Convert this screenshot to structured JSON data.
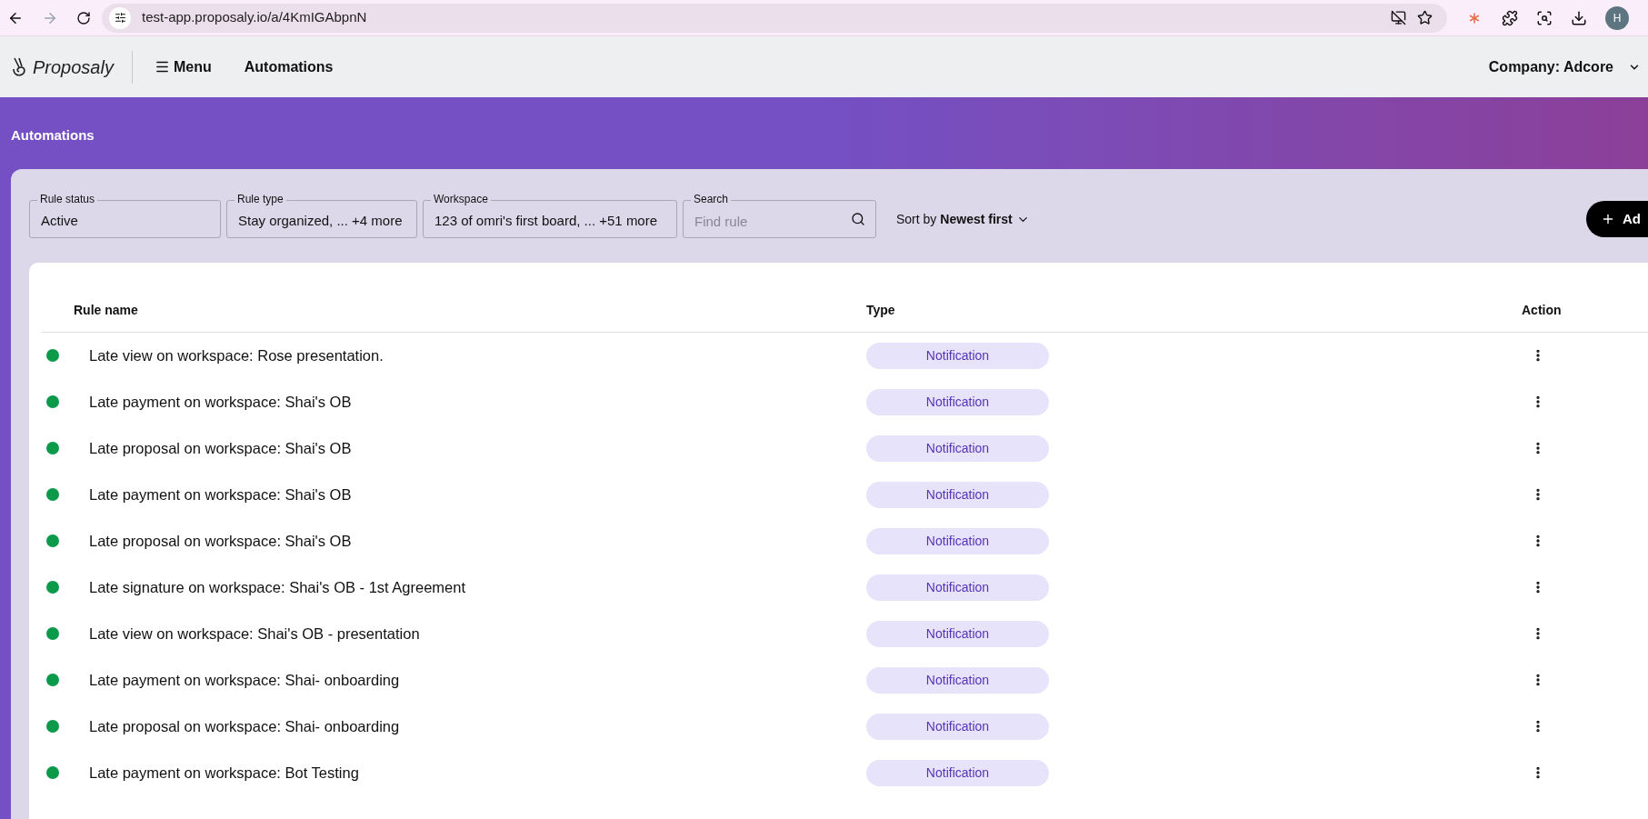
{
  "browser": {
    "url": "test-app.proposaly.io/a/4KmIGAbpnN",
    "avatar": "H"
  },
  "header": {
    "logo": "Proposaly",
    "menu": "Menu",
    "section": "Automations",
    "company": "Company: Adcore"
  },
  "page_title": "Automations",
  "filters": [
    {
      "label": "Rule status",
      "value": "Active"
    },
    {
      "label": "Rule type",
      "value": "Stay organized, ... +4 more"
    },
    {
      "label": "Workspace",
      "value": "123 of omri's first board, ... +51 more"
    }
  ],
  "search": {
    "label": "Search",
    "placeholder": "Find rule"
  },
  "sort": {
    "prefix": "Sort by",
    "value": "Newest first"
  },
  "add_button": "Ad",
  "table": {
    "columns": [
      "Rule name",
      "Type",
      "Action"
    ],
    "rows": [
      {
        "active": true,
        "name": "Late view on workspace: Rose presentation.",
        "type": "Notification"
      },
      {
        "active": true,
        "name": "Late payment on workspace: Shai's OB",
        "type": "Notification"
      },
      {
        "active": true,
        "name": "Late proposal on workspace: Shai's OB",
        "type": "Notification"
      },
      {
        "active": true,
        "name": "Late payment on workspace: Shai's OB",
        "type": "Notification"
      },
      {
        "active": true,
        "name": "Late proposal on workspace: Shai's OB",
        "type": "Notification"
      },
      {
        "active": true,
        "name": "Late signature on workspace: Shai's OB - 1st Agreement",
        "type": "Notification"
      },
      {
        "active": true,
        "name": "Late view on workspace: Shai's OB - presentation",
        "type": "Notification"
      },
      {
        "active": true,
        "name": "Late payment on workspace: Shai- onboarding",
        "type": "Notification"
      },
      {
        "active": true,
        "name": "Late proposal on workspace: Shai- onboarding",
        "type": "Notification"
      },
      {
        "active": true,
        "name": "Late payment on workspace: Bot Testing",
        "type": "Notification"
      }
    ]
  }
}
